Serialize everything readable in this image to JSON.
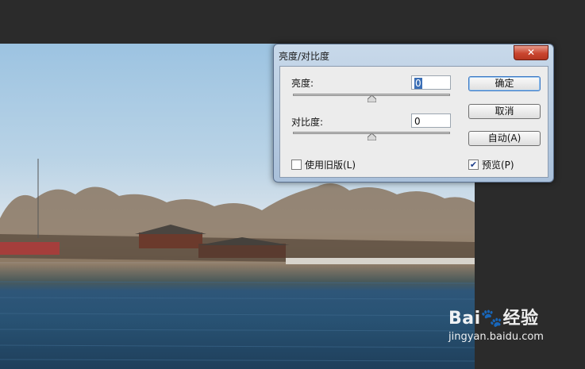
{
  "dialog": {
    "title": "亮度/对比度",
    "close_glyph": "✕",
    "brightness": {
      "label": "亮度:",
      "value": "0",
      "slider_value": 0
    },
    "contrast": {
      "label": "对比度:",
      "value": "0",
      "slider_value": 0
    },
    "buttons": {
      "ok": "确定",
      "cancel": "取消",
      "auto": "自动(A)"
    },
    "legacy": {
      "label": "使用旧版(L)",
      "checked": false
    },
    "preview": {
      "label": "预览(P)",
      "checked": true
    }
  },
  "watermark": {
    "logo": "Bai🐾经验",
    "url": "jingyan.baidu.com"
  }
}
